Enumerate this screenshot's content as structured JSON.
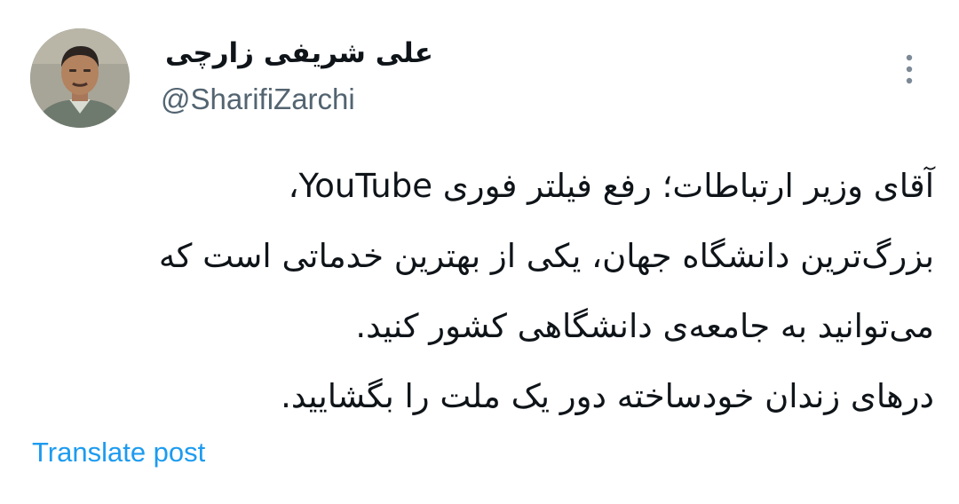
{
  "author": {
    "name": "علی شریفی زارچی",
    "handle": "@SharifiZarchi",
    "avatar_icon": "profile-photo"
  },
  "post": {
    "lines": [
      "آقای وزیر ارتباطات؛ رفع فیلتر فوری YouTube،",
      "بزرگ‌ترین دانشگاه جهان، یکی از بهترین خدماتی است که",
      "می‌توانید به جامعه‌ی دانشگاهی کشور کنید.",
      "درهای زندان خودساخته دور یک ملت را بگشایید."
    ]
  },
  "actions": {
    "more_icon": "more-vertical-icon",
    "translate_label": "Translate post"
  },
  "colors": {
    "text": "#0f1419",
    "secondary": "#536471",
    "link": "#1d9bf0",
    "background": "#ffffff"
  }
}
